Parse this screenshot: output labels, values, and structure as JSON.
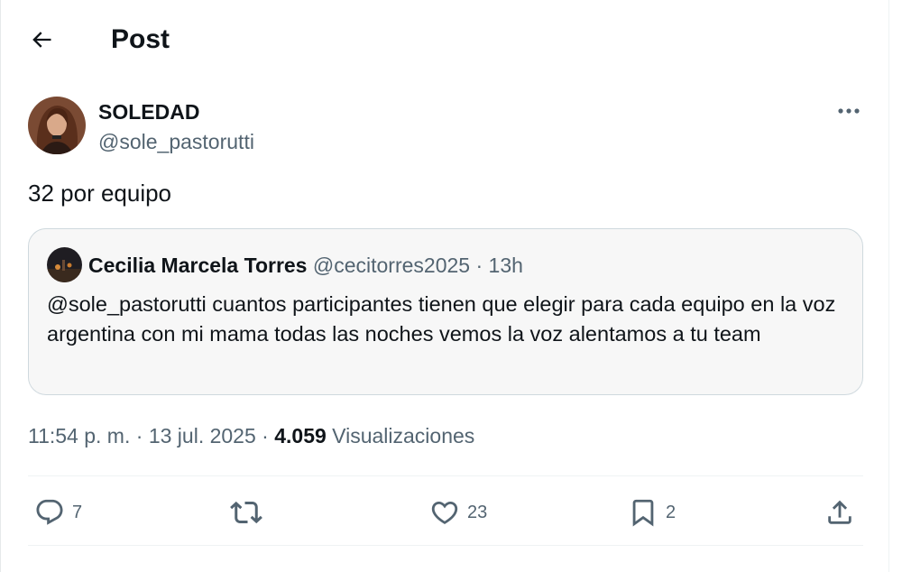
{
  "header": {
    "title": "Post",
    "back_icon": "arrow-left-icon"
  },
  "post": {
    "author": {
      "display_name": "SOLEDAD",
      "handle": "@sole_pastorutti"
    },
    "text": "32 por equipo",
    "time": "11:54 p. m.",
    "date": "13 jul. 2025",
    "views_count": "4.059",
    "views_label": "Visualizaciones",
    "separator": "·"
  },
  "quoted": {
    "display_name": "Cecilia Marcela Torres",
    "handle": "@cecitorres2025",
    "age": "13h",
    "separator": "·",
    "text": "@sole_pastorutti cuantos participantes tienen que elegir para cada equipo en la voz argentina con mi mama todas  las noches vemos la voz  alentamos a tu team"
  },
  "actions": {
    "replies": "7",
    "reposts": "",
    "likes": "23",
    "bookmarks": "2"
  },
  "colors": {
    "text_primary": "#0f1419",
    "text_secondary": "#536471",
    "border": "#cfd9de",
    "quote_bg": "#f7f7f7"
  }
}
